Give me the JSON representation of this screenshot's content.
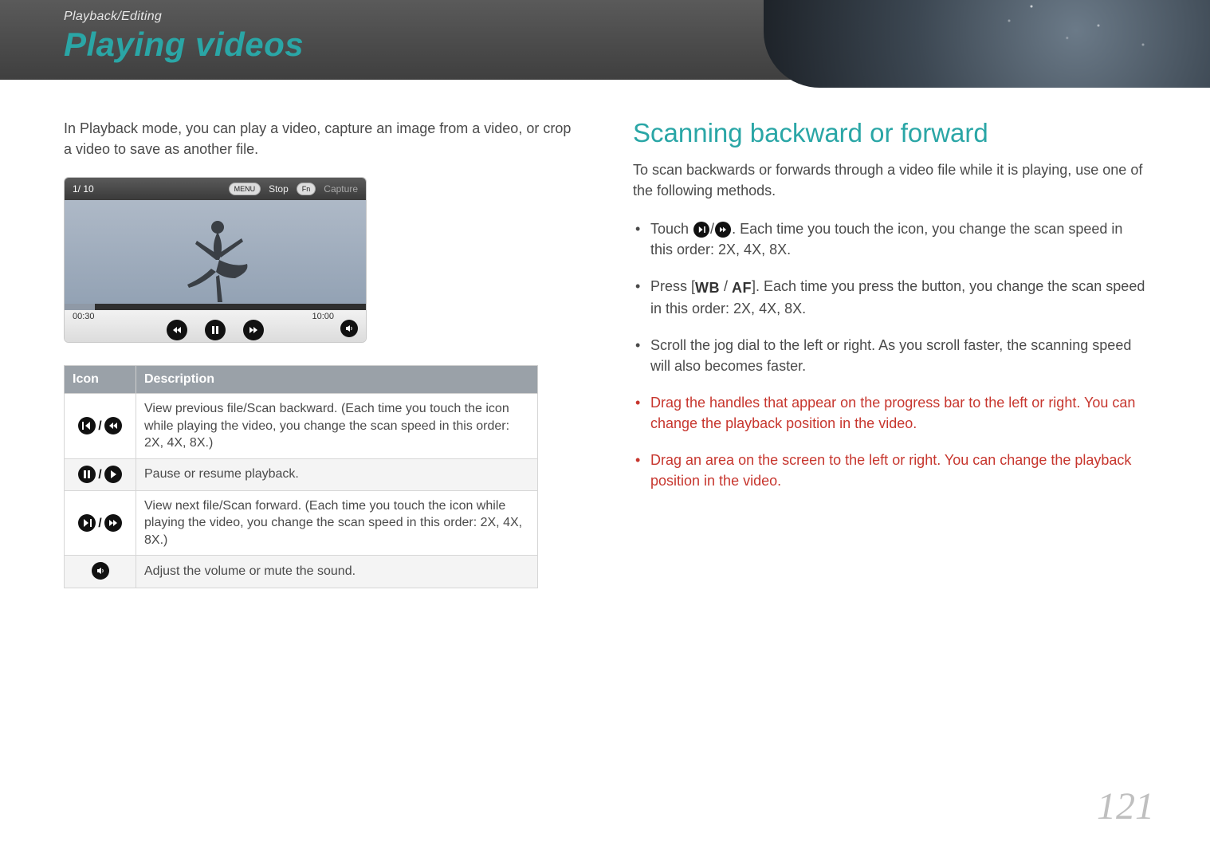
{
  "header": {
    "breadcrumb": "Playback/Editing",
    "title": "Playing videos"
  },
  "left": {
    "intro": "In Playback mode, you can play a video, capture an image from a video, or crop a video to save as another file.",
    "video_mock": {
      "counter": "1/ 10",
      "menu_pill": "MENU",
      "stop_label": "Stop",
      "fn_pill": "Fn",
      "capture_label": "Capture",
      "time_left": "00:30",
      "time_right": "10:00"
    },
    "table": {
      "headers": {
        "icon": "Icon",
        "desc": "Description"
      },
      "rows": [
        {
          "icon_ids": [
            "prev-file-icon",
            "scan-backward-icon"
          ],
          "desc": "View previous file/Scan backward. (Each time you touch the icon while playing the video, you change the scan speed in this order: 2X, 4X, 8X.)"
        },
        {
          "icon_ids": [
            "pause-icon",
            "play-icon"
          ],
          "desc": "Pause or resume playback."
        },
        {
          "icon_ids": [
            "next-file-icon",
            "scan-forward-icon"
          ],
          "desc": "View next file/Scan forward. (Each time you touch the icon while playing the video, you change the scan speed in this order: 2X, 4X, 8X.)"
        },
        {
          "icon_ids": [
            "volume-icon"
          ],
          "desc": "Adjust the volume or mute the sound."
        }
      ]
    }
  },
  "right": {
    "heading": "Scanning backward or forward",
    "intro": "To scan backwards or forwards through a video file while it is playing, use one of the following methods.",
    "bullets": [
      {
        "pre": "Touch ",
        "icons": [
          "next-file-icon",
          "scan-forward-icon"
        ],
        "post": ". Each time you touch the icon, you change the scan speed in this order: 2X, 4X, 8X.",
        "red": false
      },
      {
        "pre": "Press [",
        "wb": "WB",
        "af": "AF",
        "post": "]. Each time you press the button, you change the scan speed in this order: 2X, 4X, 8X.",
        "red": false
      },
      {
        "text": "Scroll the jog dial to the left or right. As you scroll faster, the scanning speed will also becomes faster.",
        "red": false
      },
      {
        "text": "Drag the handles that appear on the progress bar to the left or right. You can change the playback position in the video.",
        "red": true
      },
      {
        "text": "Drag an area on the screen to the left or right. You can change the playback position in the video.",
        "red": true
      }
    ]
  },
  "page_number": "121"
}
